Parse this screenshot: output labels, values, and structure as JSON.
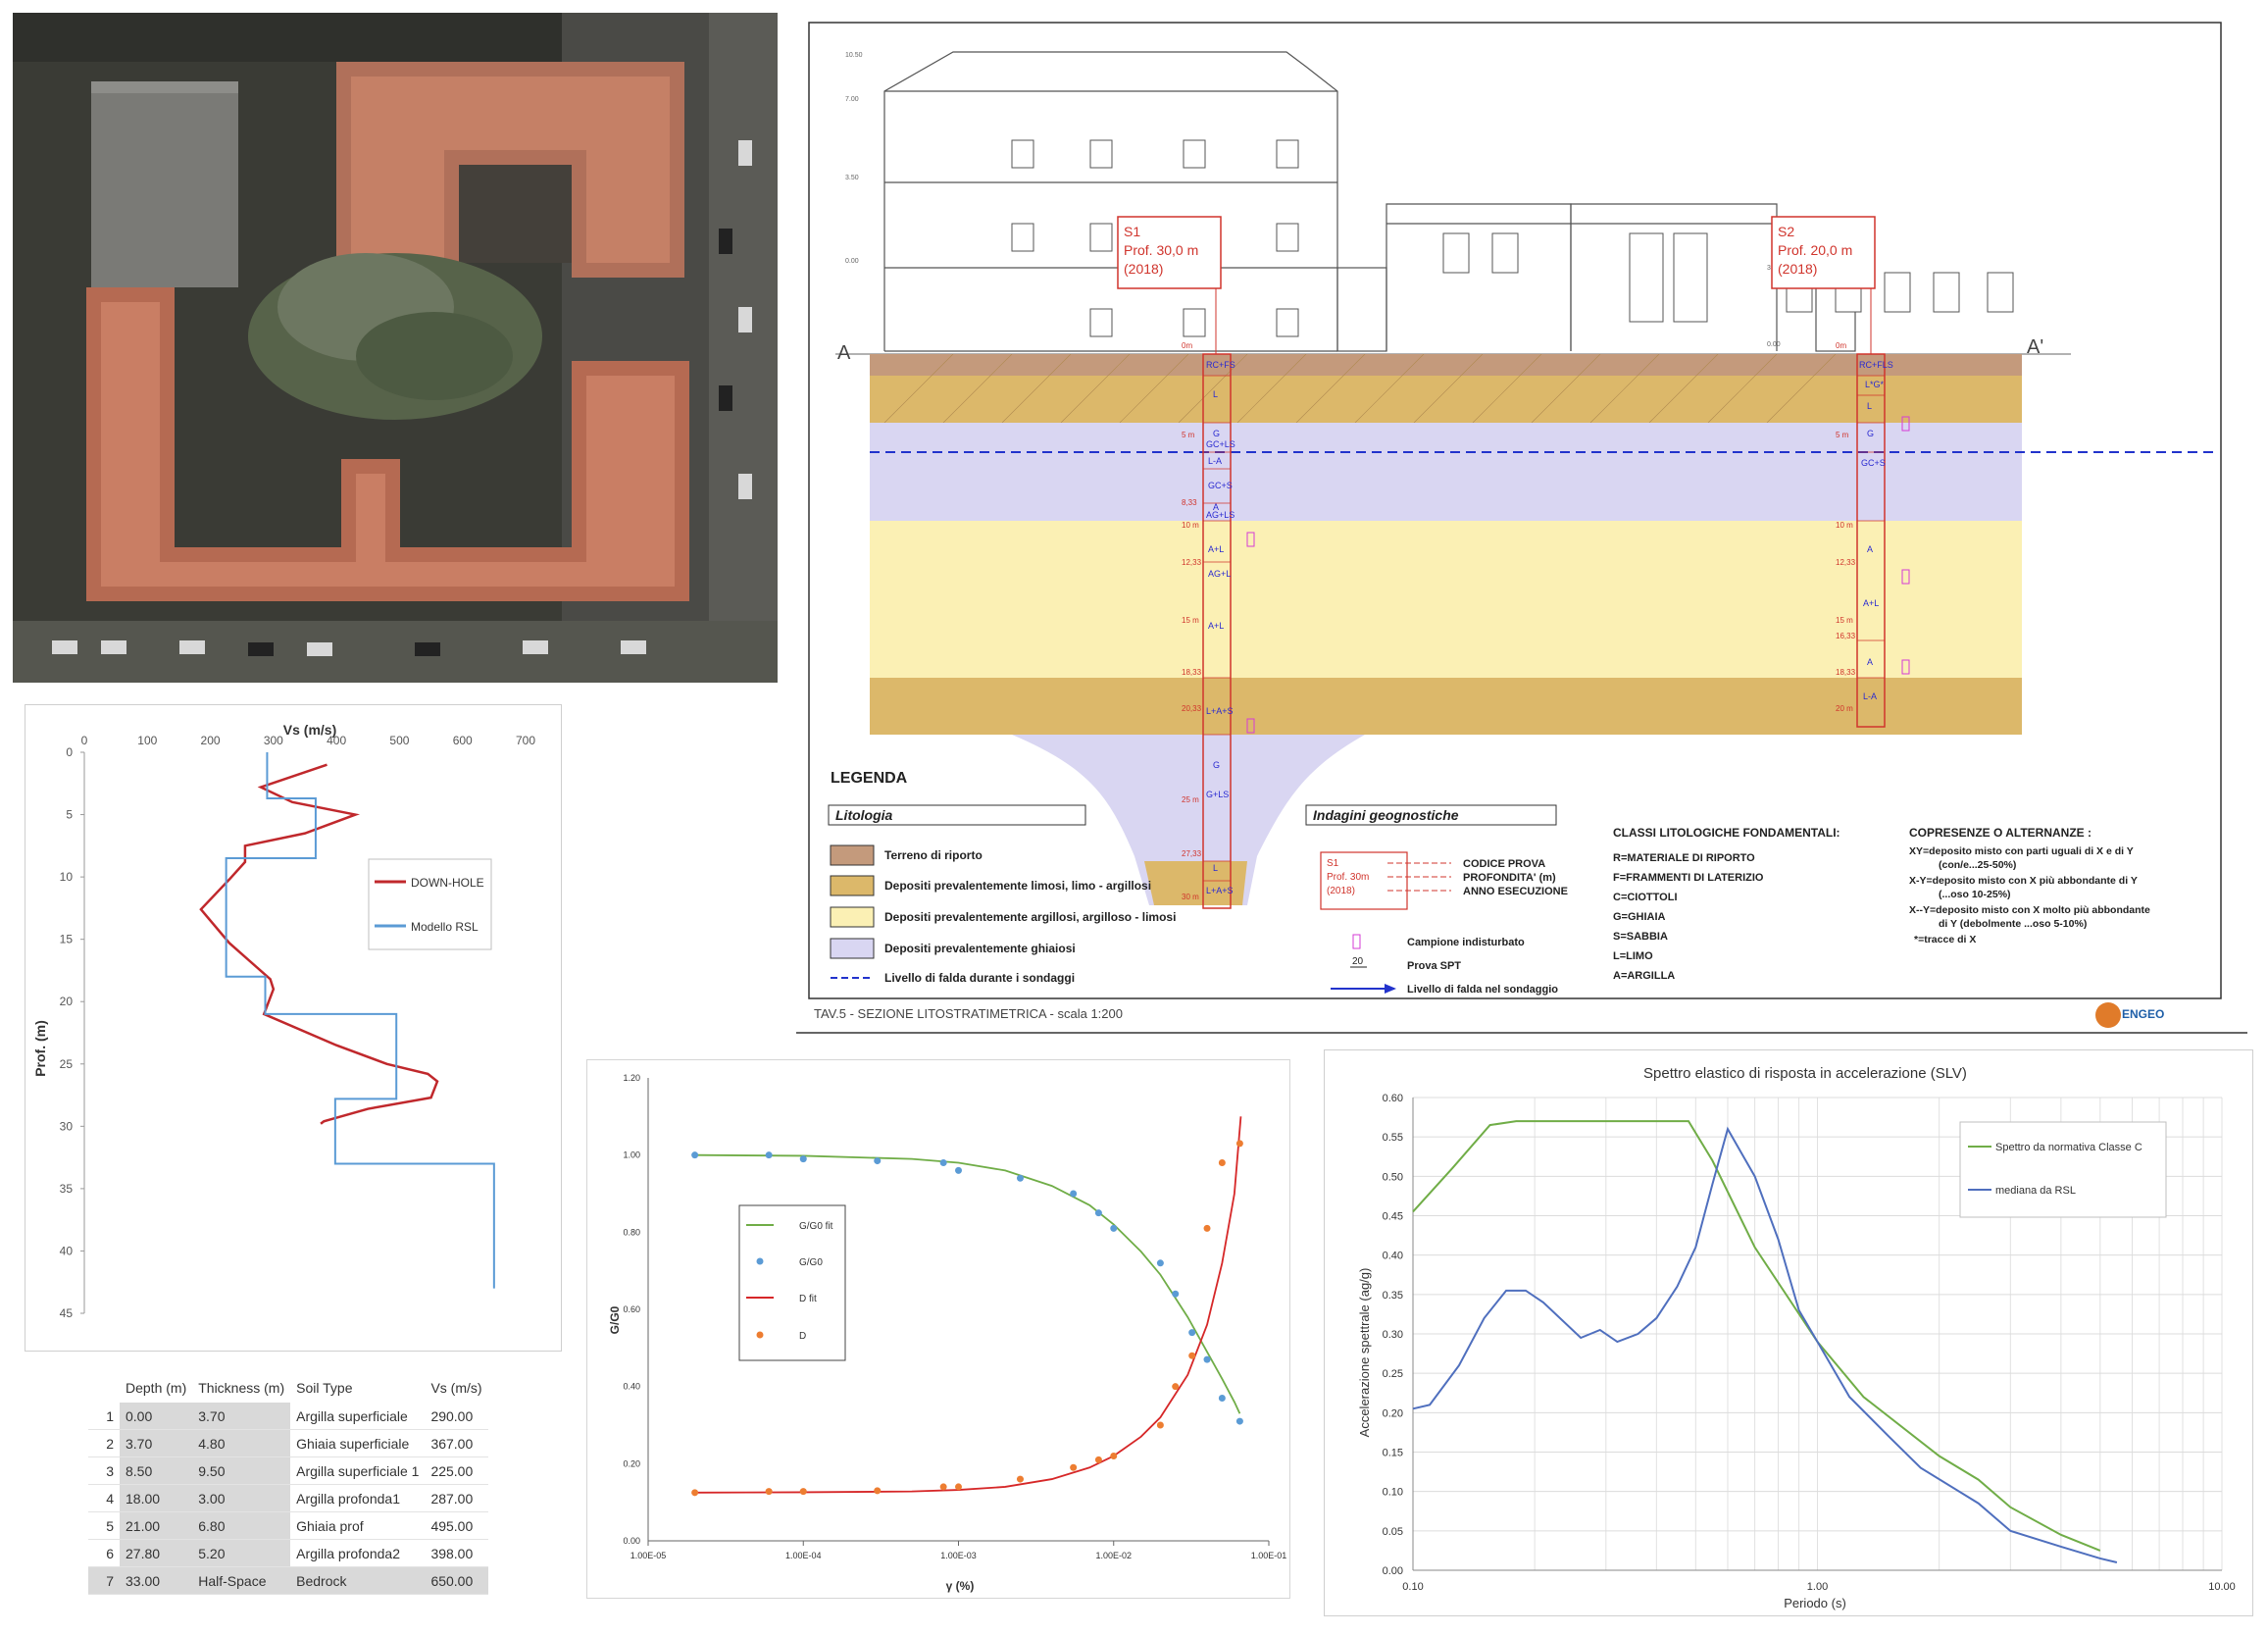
{
  "section": {
    "label_a": "A",
    "label_a_prime": "A'",
    "s1": {
      "code": "S1",
      "depth": "Prof. 30,0 m",
      "year": "(2018)"
    },
    "s2": {
      "code": "S2",
      "depth": "Prof. 20,0 m",
      "year": "(2018)"
    },
    "legend_title": "LEGENDA",
    "litologia_title": "Litologia",
    "indagini_title": "Indagini geognostiche",
    "lithology": [
      {
        "label": "Terreno di riporto",
        "color": "#c49a7c"
      },
      {
        "label": "Depositi prevalentemente limosi, limo - argillosi",
        "color": "#dcb86a"
      },
      {
        "label": "Depositi prevalentemente argillosi, argilloso - limosi",
        "color": "#fbf0b4"
      },
      {
        "label": "Depositi prevalentemente ghiaiosi",
        "color": "#d9d6f2"
      },
      {
        "label": "Livello di falda durante i sondaggi",
        "color": "#2233cc"
      }
    ],
    "probe_legend": {
      "code": "S1",
      "depth": "Prof. 30m",
      "year": "(2018)",
      "codice": "CODICE PROVA",
      "profondita": "PROFONDITA' (m)",
      "anno": "ANNO ESECUZIONE",
      "campione": "Campione indisturbato",
      "spt": "Prova SPT",
      "spt_value": "20",
      "falda": "Livello di falda nel sondaggio"
    },
    "classes_title": "CLASSI LITOLOGICHE FONDAMENTALI:",
    "classes": [
      "R=MATERIALE DI RIPORTO",
      "F=FRAMMENTI DI LATERIZIO",
      "C=CIOTTOLI",
      "G=GHIAIA",
      "S=SABBIA",
      "L=LIMO",
      "A=ARGILLA"
    ],
    "compresence_title": "COPRESENZE O ALTERNANZE :",
    "compresence": [
      "XY=deposito misto con parti uguali di X e di Y",
      "(con/e...25-50%)",
      "X-Y=deposito misto con X più abbondante di Y",
      "(...oso 10-25%)",
      "X--Y=deposito misto con X molto più abbondante",
      "di Y (debolmente ...oso 5-10%)",
      "*=tracce di X"
    ],
    "footer": "TAV.5 - SEZIONE LITOSTRATIMETRICA - scala 1:200",
    "logo": "ENGEO",
    "s1_layers": [
      "RC+FS",
      "L",
      "G",
      "GC+LS",
      "L-A",
      "GC+S",
      "A",
      "AG+LS",
      "A+L",
      "AG+L",
      "A+L",
      "L+A+S",
      "G",
      "G+LS",
      "L",
      "L+A+S"
    ],
    "s2_layers": [
      "RC+FLS",
      "L*G*",
      "L",
      "G",
      "GC+S",
      "A",
      "A+L",
      "A",
      "L-A"
    ],
    "s1_depths": [
      "0m",
      "5 m",
      "8,33",
      "10 m",
      "12,33",
      "15 m",
      "18,33",
      "20,33",
      "25 m",
      "27,33",
      "30 m"
    ],
    "s2_depths": [
      "0m",
      "5 m",
      "10 m",
      "12,33",
      "15 m",
      "16,33",
      "18,33",
      "20 m"
    ],
    "scale_marks": [
      "0.00",
      "3.50",
      "7.00",
      "10.50",
      "0.00",
      "3.50"
    ]
  },
  "vs_profile": {
    "chart_data": {
      "type": "line",
      "title": "Vs (m/s)",
      "xlabel": "Vs (m/s)",
      "ylabel": "Prof. (m)",
      "xlim": [
        0,
        700
      ],
      "ylim": [
        0,
        45
      ],
      "x_ticks": [
        "0",
        "100",
        "200",
        "300",
        "400",
        "500",
        "600",
        "700"
      ],
      "y_ticks": [
        "0",
        "5",
        "10",
        "15",
        "20",
        "25",
        "30",
        "35",
        "40",
        "45"
      ],
      "series": [
        {
          "name": "DOWN-HOLE",
          "color": "#c0282c",
          "points": [
            [
              385,
              1.0
            ],
            [
              280,
              2.8
            ],
            [
              330,
              4.0
            ],
            [
              430,
              5.0
            ],
            [
              350,
              6.5
            ],
            [
              255,
              7.5
            ],
            [
              255,
              8.8
            ],
            [
              230,
              10.2
            ],
            [
              215,
              11.0
            ],
            [
              185,
              12.6
            ],
            [
              230,
              15.3
            ],
            [
              295,
              18.2
            ],
            [
              300,
              19.0
            ],
            [
              285,
              21.0
            ],
            [
              400,
              23.5
            ],
            [
              480,
              25.0
            ],
            [
              545,
              25.8
            ],
            [
              560,
              26.4
            ],
            [
              550,
              27.7
            ],
            [
              450,
              28.6
            ],
            [
              380,
              29.6
            ],
            [
              375,
              29.8
            ]
          ]
        },
        {
          "name": "Modello RSL",
          "color": "#5b9bd5",
          "points": [
            [
              290,
              0
            ],
            [
              290,
              3.7
            ],
            [
              367,
              3.7
            ],
            [
              367,
              8.5
            ],
            [
              225,
              8.5
            ],
            [
              225,
              18.0
            ],
            [
              287,
              18.0
            ],
            [
              287,
              21.0
            ],
            [
              495,
              21.0
            ],
            [
              495,
              27.8
            ],
            [
              398,
              27.8
            ],
            [
              398,
              33.0
            ],
            [
              650,
              33.0
            ],
            [
              650,
              43.0
            ]
          ]
        }
      ],
      "legend_position": "right"
    }
  },
  "soil_table": {
    "headers": [
      "Depth (m)",
      "Thickness (m)",
      "Soil Type",
      "Vs (m/s)"
    ],
    "rows": [
      {
        "idx": "1",
        "depth": "0.00",
        "thickness": "3.70",
        "soil": "Argilla superficiale",
        "vs": "290.00"
      },
      {
        "idx": "2",
        "depth": "3.70",
        "thickness": "4.80",
        "soil": "Ghiaia superficiale",
        "vs": "367.00"
      },
      {
        "idx": "3",
        "depth": "8.50",
        "thickness": "9.50",
        "soil": "Argilla superficiale 1",
        "vs": "225.00"
      },
      {
        "idx": "4",
        "depth": "18.00",
        "thickness": "3.00",
        "soil": "Argilla profonda1",
        "vs": "287.00"
      },
      {
        "idx": "5",
        "depth": "21.00",
        "thickness": "6.80",
        "soil": "Ghiaia prof",
        "vs": "495.00"
      },
      {
        "idx": "6",
        "depth": "27.80",
        "thickness": "5.20",
        "soil": "Argilla profonda2",
        "vs": "398.00"
      },
      {
        "idx": "7",
        "depth": "33.00",
        "thickness": "Half-Space",
        "soil": "Bedrock",
        "vs": "650.00"
      }
    ]
  },
  "ggo": {
    "chart_data": {
      "type": "scatter",
      "xlabel": "γ (%)",
      "ylabel": "G/G0",
      "x_scale": "log",
      "xlim": [
        1e-05,
        0.1
      ],
      "ylim": [
        0,
        1.2
      ],
      "x_ticks": [
        "1.00E-05",
        "1.00E-04",
        "1.00E-03",
        "1.00E-02",
        "1.00E-01"
      ],
      "y_ticks": [
        "0.00",
        "0.20",
        "0.40",
        "0.60",
        "0.80",
        "1.00",
        "1.20"
      ],
      "series": [
        {
          "name": "G/G0 fit",
          "kind": "line",
          "color": "#70ad47",
          "points": [
            [
              2e-05,
              1.0
            ],
            [
              0.0001,
              0.998
            ],
            [
              0.0005,
              0.99
            ],
            [
              0.001,
              0.98
            ],
            [
              0.002,
              0.96
            ],
            [
              0.004,
              0.92
            ],
            [
              0.007,
              0.87
            ],
            [
              0.01,
              0.82
            ],
            [
              0.015,
              0.75
            ],
            [
              0.02,
              0.69
            ],
            [
              0.03,
              0.58
            ],
            [
              0.04,
              0.49
            ],
            [
              0.05,
              0.42
            ],
            [
              0.06,
              0.36
            ],
            [
              0.065,
              0.33
            ]
          ]
        },
        {
          "name": "G/G0",
          "kind": "points",
          "color": "#5b9bd5",
          "points": [
            [
              2e-05,
              1.0
            ],
            [
              6e-05,
              1.0
            ],
            [
              0.0001,
              0.99
            ],
            [
              0.0003,
              0.985
            ],
            [
              0.0008,
              0.98
            ],
            [
              0.001,
              0.96
            ],
            [
              0.0025,
              0.94
            ],
            [
              0.0055,
              0.9
            ],
            [
              0.008,
              0.85
            ],
            [
              0.01,
              0.81
            ],
            [
              0.02,
              0.72
            ],
            [
              0.025,
              0.64
            ],
            [
              0.032,
              0.54
            ],
            [
              0.04,
              0.47
            ],
            [
              0.05,
              0.37
            ],
            [
              0.065,
              0.31
            ]
          ]
        },
        {
          "name": "D fit",
          "kind": "line",
          "color": "#d62728",
          "points": [
            [
              2e-05,
              0.125
            ],
            [
              0.0001,
              0.126
            ],
            [
              0.0005,
              0.128
            ],
            [
              0.001,
              0.132
            ],
            [
              0.002,
              0.14
            ],
            [
              0.004,
              0.16
            ],
            [
              0.007,
              0.19
            ],
            [
              0.01,
              0.22
            ],
            [
              0.015,
              0.27
            ],
            [
              0.02,
              0.32
            ],
            [
              0.03,
              0.43
            ],
            [
              0.04,
              0.56
            ],
            [
              0.05,
              0.72
            ],
            [
              0.06,
              0.9
            ],
            [
              0.066,
              1.1
            ]
          ]
        },
        {
          "name": "D",
          "kind": "points",
          "color": "#ed7d31",
          "points": [
            [
              2e-05,
              0.125
            ],
            [
              6e-05,
              0.128
            ],
            [
              0.0001,
              0.128
            ],
            [
              0.0003,
              0.13
            ],
            [
              0.0008,
              0.14
            ],
            [
              0.001,
              0.14
            ],
            [
              0.0025,
              0.16
            ],
            [
              0.0055,
              0.19
            ],
            [
              0.008,
              0.21
            ],
            [
              0.01,
              0.22
            ],
            [
              0.02,
              0.3
            ],
            [
              0.025,
              0.4
            ],
            [
              0.032,
              0.48
            ],
            [
              0.04,
              0.81
            ],
            [
              0.05,
              0.98
            ],
            [
              0.065,
              1.03
            ]
          ]
        }
      ],
      "legend_position": "left"
    }
  },
  "spectrum": {
    "chart_data": {
      "type": "line",
      "title": "Spettro elastico di risposta in accelerazione (SLV)",
      "xlabel": "Periodo (s)",
      "ylabel": "Accelerazione spettrale (ag/g)",
      "x_scale": "log",
      "xlim": [
        0.1,
        10
      ],
      "ylim": [
        0,
        0.6
      ],
      "x_ticks": [
        "0.10",
        "1.00",
        "10.00"
      ],
      "y_ticks": [
        "0.00",
        "0.05",
        "0.10",
        "0.15",
        "0.20",
        "0.25",
        "0.30",
        "0.35",
        "0.40",
        "0.45",
        "0.50",
        "0.55",
        "0.60"
      ],
      "series": [
        {
          "name": "Spettro da normativa Classe C",
          "color": "#70ad47",
          "points": [
            [
              0.1,
              0.455
            ],
            [
              0.125,
              0.51
            ],
            [
              0.155,
              0.565
            ],
            [
              0.18,
              0.57
            ],
            [
              0.3,
              0.57
            ],
            [
              0.48,
              0.57
            ],
            [
              0.55,
              0.52
            ],
            [
              0.7,
              0.41
            ],
            [
              1.0,
              0.29
            ],
            [
              1.3,
              0.22
            ],
            [
              2.0,
              0.145
            ],
            [
              2.5,
              0.115
            ],
            [
              3.0,
              0.08
            ],
            [
              4.0,
              0.045
            ],
            [
              5.0,
              0.025
            ]
          ]
        },
        {
          "name": "mediana da RSL",
          "color": "#4f6fbe",
          "points": [
            [
              0.1,
              0.205
            ],
            [
              0.11,
              0.21
            ],
            [
              0.13,
              0.26
            ],
            [
              0.15,
              0.32
            ],
            [
              0.17,
              0.355
            ],
            [
              0.19,
              0.355
            ],
            [
              0.21,
              0.34
            ],
            [
              0.26,
              0.295
            ],
            [
              0.29,
              0.305
            ],
            [
              0.32,
              0.29
            ],
            [
              0.36,
              0.3
            ],
            [
              0.4,
              0.32
            ],
            [
              0.45,
              0.36
            ],
            [
              0.5,
              0.41
            ],
            [
              0.55,
              0.49
            ],
            [
              0.6,
              0.56
            ],
            [
              0.7,
              0.5
            ],
            [
              0.8,
              0.42
            ],
            [
              0.9,
              0.33
            ],
            [
              1.0,
              0.29
            ],
            [
              1.2,
              0.22
            ],
            [
              1.5,
              0.17
            ],
            [
              1.8,
              0.13
            ],
            [
              2.5,
              0.085
            ],
            [
              3.0,
              0.05
            ],
            [
              4.0,
              0.03
            ],
            [
              5.0,
              0.015
            ],
            [
              5.5,
              0.01
            ]
          ]
        }
      ],
      "legend_position": "top-right"
    }
  }
}
